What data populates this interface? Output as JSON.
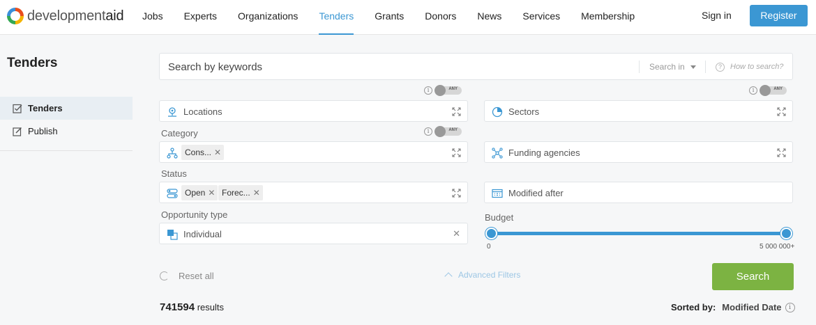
{
  "header": {
    "logo_part1": "development",
    "logo_part2": "aid",
    "nav": [
      "Jobs",
      "Experts",
      "Organizations",
      "Tenders",
      "Grants",
      "Donors",
      "News",
      "Services",
      "Membership"
    ],
    "active_nav": "Tenders",
    "signin": "Sign in",
    "register": "Register",
    "accent_color": "#3b97d3"
  },
  "sidebar": {
    "title": "Tenders",
    "items": [
      {
        "label": "Tenders",
        "icon": "checklist-icon",
        "active": true
      },
      {
        "label": "Publish",
        "icon": "edit-icon",
        "active": false
      }
    ]
  },
  "search": {
    "placeholder": "Search by keywords",
    "search_in": "Search in",
    "how_to": "How to search?"
  },
  "toggle_label": "ANY",
  "filters": {
    "locations": "Locations",
    "sectors": "Sectors",
    "category_label": "Category",
    "category_chip": "Cons...",
    "funding": "Funding agencies",
    "status_label": "Status",
    "status_chips": [
      "Open",
      "Forec..."
    ],
    "modified_after": "Modified after",
    "opportunity_label": "Opportunity type",
    "opportunity_value": "Individual",
    "budget_label": "Budget",
    "budget_min": "0",
    "budget_max": "5 000 000+"
  },
  "actions": {
    "reset": "Reset all",
    "advanced": "Advanced Filters",
    "search": "Search",
    "search_color": "#7cb342"
  },
  "results": {
    "count": "741594",
    "suffix": "results",
    "sorted_label": "Sorted by:",
    "sorted_value": "Modified Date"
  }
}
